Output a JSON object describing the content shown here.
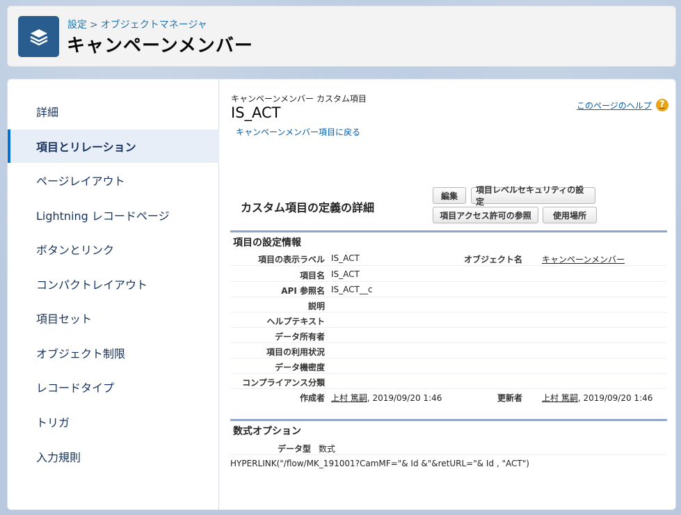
{
  "header": {
    "breadcrumb_setup": "設定",
    "breadcrumb_sep": ">",
    "breadcrumb_object_manager": "オブジェクトマネージャ",
    "title": "キャンペーンメンバー"
  },
  "sidebar": {
    "items": [
      {
        "label": "詳細"
      },
      {
        "label": "項目とリレーション"
      },
      {
        "label": "ページレイアウト"
      },
      {
        "label": "Lightning レコードページ"
      },
      {
        "label": "ボタンとリンク"
      },
      {
        "label": "コンパクトレイアウト"
      },
      {
        "label": "項目セット"
      },
      {
        "label": "オブジェクト制限"
      },
      {
        "label": "レコードタイプ"
      },
      {
        "label": "トリガ"
      },
      {
        "label": "入力規則"
      }
    ],
    "active_index": 1
  },
  "content": {
    "object_subtitle": "キャンペーンメンバー カスタム項目",
    "field_name": "IS_ACT",
    "back_link": "キャンペーンメンバー項目に戻る",
    "help_link": "このページのヘルプ",
    "section_title": "カスタム項目の定義の詳細",
    "buttons": {
      "edit": "編集",
      "fls": "項目レベルセキュリティの設定",
      "access": "項目アクセス許可の参照",
      "where_used": "使用場所"
    },
    "info_header": "項目の設定情報",
    "rows": [
      {
        "label": "項目の表示ラベル",
        "value": "IS_ACT",
        "label2": "オブジェクト名",
        "value2": "キャンペーンメンバー"
      },
      {
        "label": "項目名",
        "value": "IS_ACT"
      },
      {
        "label": "API 参照名",
        "value": "IS_ACT__c"
      },
      {
        "label": "説明",
        "value": ""
      },
      {
        "label": "ヘルプテキスト",
        "value": ""
      },
      {
        "label": "データ所有者",
        "value": ""
      },
      {
        "label": "項目の利用状況",
        "value": ""
      },
      {
        "label": "データ機密度",
        "value": ""
      },
      {
        "label": "コンプライアンス分類",
        "value": ""
      }
    ],
    "created_by": {
      "label": "作成者",
      "user": "上村 篤嗣",
      "date": ", 2019/09/20 1:46"
    },
    "modified_by": {
      "label": "更新者",
      "user": "上村 篤嗣",
      "date": ", 2019/09/20 1:46"
    },
    "formula_header": "数式オプション",
    "data_type_label": "データ型",
    "data_type_value": "数式",
    "formula": "HYPERLINK(\"/flow/MK_191001?CamMF=\"& Id &\"&retURL=\"& Id , \"ACT\")"
  },
  "icons": {
    "object_icon": "layers-icon",
    "help_icon": "question-icon"
  },
  "colors": {
    "brand_blue": "#2a5d8f",
    "active_bar": "#0070d2",
    "link": "#015ba7",
    "help": "#e8a317"
  }
}
